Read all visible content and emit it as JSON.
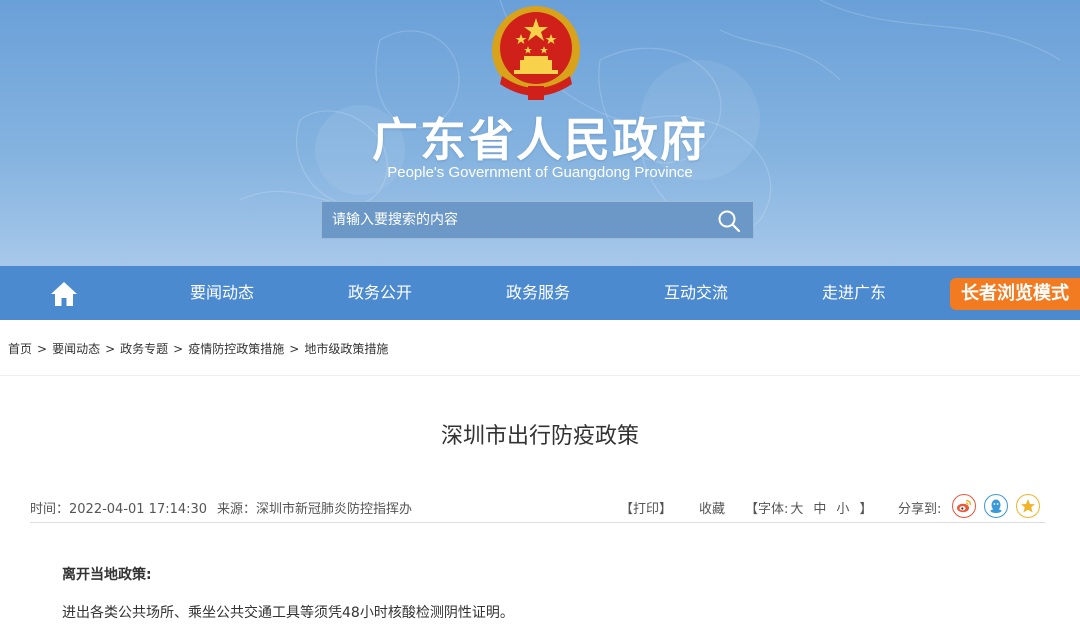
{
  "header": {
    "title": "广东省人民政府",
    "subtitle": "People's Government of Guangdong Province",
    "emblem_icon": "national-emblem-icon"
  },
  "search": {
    "placeholder": "请输入要搜索的内容",
    "icon": "search-icon"
  },
  "nav": {
    "home_icon": "home-icon",
    "items": [
      {
        "label": "要闻动态"
      },
      {
        "label": "政务公开"
      },
      {
        "label": "政务服务"
      },
      {
        "label": "互动交流"
      },
      {
        "label": "走进广东"
      }
    ],
    "elder_mode_label": "长者浏览模式"
  },
  "breadcrumb": {
    "items": [
      "首页",
      "要闻动态",
      "政务专题",
      "疫情防控政策措施",
      "地市级政策措施"
    ],
    "separator": ">"
  },
  "article": {
    "title": "深圳市出行防疫政策",
    "meta": {
      "time": "时间：2022-04-01 17:14:30",
      "source": "来源：深圳市新冠肺炎防控指挥办",
      "print": "【打印】",
      "favorite": "收藏",
      "font_label": "【字体:",
      "font_large": "大",
      "font_medium": "中",
      "font_small": "小",
      "font_close": "】",
      "share_label": "分享到:"
    },
    "section_heading": "离开当地政策:",
    "paragraph_1": "进出各类公共场所、乘坐公共交通工具等须凭48小时核酸检测阴性证明。"
  },
  "colors": {
    "header_bg": "#7aaadd",
    "nav_bg": "#4c8ad0",
    "elder_mode_bg": "#f27b21",
    "weibo": "#e8583b",
    "qq": "#3a9ad8",
    "qzone": "#f0b429"
  }
}
